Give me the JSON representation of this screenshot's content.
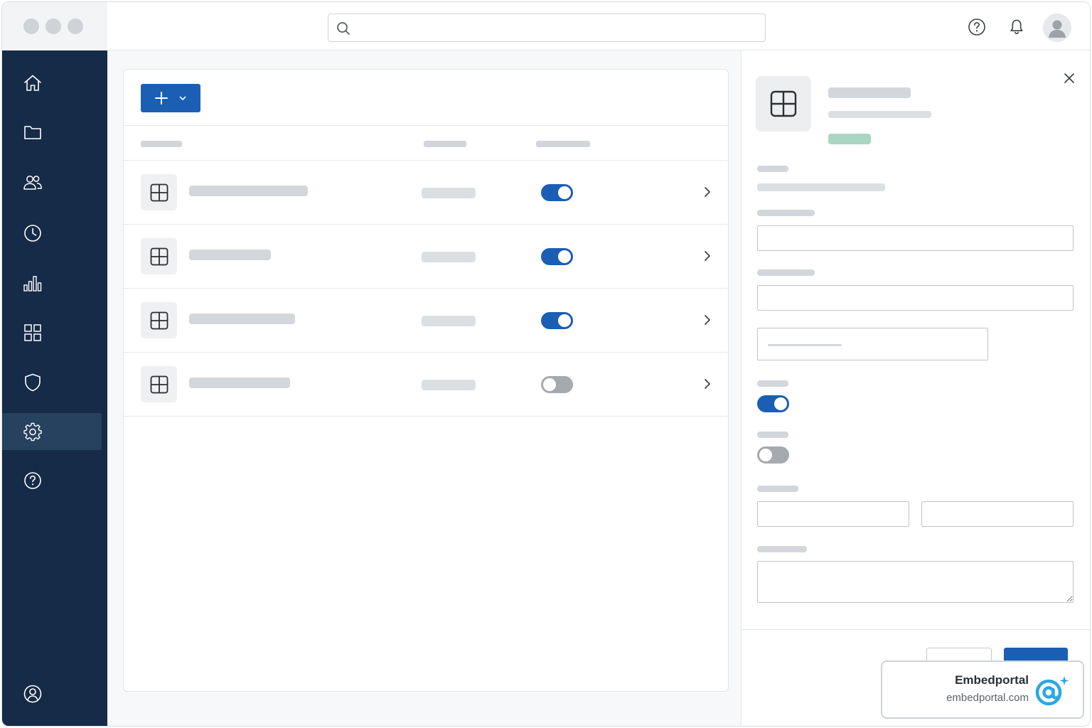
{
  "window": {
    "controls": [
      "close",
      "minimize",
      "maximize"
    ]
  },
  "search": {
    "placeholder": "",
    "value": ""
  },
  "header_icons": [
    "help-icon",
    "bell-icon",
    "user-avatar"
  ],
  "sidebar": {
    "items": [
      {
        "icon": "home-icon",
        "active": false
      },
      {
        "icon": "folder-icon",
        "active": false
      },
      {
        "icon": "users-icon",
        "active": false
      },
      {
        "icon": "clock-icon",
        "active": false
      },
      {
        "icon": "bar-chart-icon",
        "active": false
      },
      {
        "icon": "grid-icon",
        "active": false
      },
      {
        "icon": "shield-icon",
        "active": false
      },
      {
        "icon": "gear-icon",
        "active": true
      },
      {
        "icon": "help-icon",
        "active": false
      }
    ],
    "bottom_item": {
      "icon": "account-icon"
    }
  },
  "list": {
    "add_button": {
      "icons": [
        "plus-icon",
        "chevron-down-icon"
      ]
    },
    "rows": [
      {
        "enabled": true
      },
      {
        "enabled": true
      },
      {
        "enabled": true
      },
      {
        "enabled": false
      }
    ]
  },
  "detail_panel": {
    "status_badge_color": "#a9d5c2",
    "toggle_1_enabled": true,
    "toggle_2_enabled": false
  },
  "watermark": {
    "name": "Embedportal",
    "url": "embedportal.com"
  },
  "colors": {
    "sidebar_bg": "#152b47",
    "sidebar_active": "#27425f",
    "accent": "#1a5fb4",
    "skeleton": "#d3d6da",
    "badge": "#a9d5c2",
    "logo": "#2aa8e0"
  }
}
